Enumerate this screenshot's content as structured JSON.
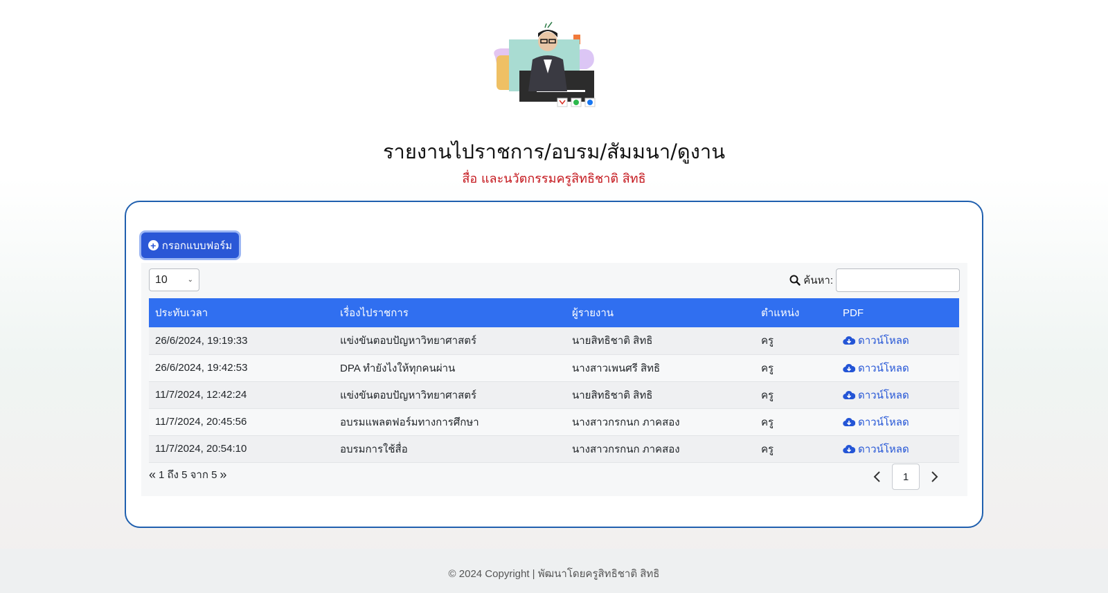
{
  "header": {
    "title": "รายงานไปราชการ/อบรม/สัมมนา/ดูงาน",
    "subtitle": "สื่อ และนวัตกรรมครูสิทธิชาติ สิทธิ"
  },
  "toolbar": {
    "add_form_label": "กรอกแบบฟอร์ม"
  },
  "table_controls": {
    "page_length": "10",
    "search_label": "ค้นหา:",
    "search_value": ""
  },
  "table": {
    "columns": [
      "ประทับเวลา",
      "เรื่องไปราชการ",
      "ผู้รายงาน",
      "ตำแหน่ง",
      "PDF"
    ],
    "rows": [
      {
        "timestamp": "26/6/2024, 19:19:33",
        "subject": "แข่งขันตอบปัญหาวิทยาศาสตร์",
        "reporter": "นายสิทธิชาติ สิทธิ",
        "position": "ครู",
        "pdf": "ดาวน์โหลด"
      },
      {
        "timestamp": "26/6/2024, 19:42:53",
        "subject": "DPA ทำยังไงให้ทุกคนผ่าน",
        "reporter": "นางสาวเพนศรี สิทธิ",
        "position": "ครู",
        "pdf": "ดาวน์โหลด"
      },
      {
        "timestamp": "11/7/2024, 12:42:24",
        "subject": "แข่งขันตอบปัญหาวิทยาศาสตร์",
        "reporter": "นายสิทธิชาติ สิทธิ",
        "position": "ครู",
        "pdf": "ดาวน์โหลด"
      },
      {
        "timestamp": "11/7/2024, 20:45:56",
        "subject": "อบรมแพลตฟอร์มทางการศึกษา",
        "reporter": "นางสาวกรกนก ภาคสอง",
        "position": "ครู",
        "pdf": "ดาวน์โหลด"
      },
      {
        "timestamp": "11/7/2024, 20:54:10",
        "subject": "อบรมการใช้สื่อ",
        "reporter": "นางสาวกรกนก ภาคสอง",
        "position": "ครู",
        "pdf": "ดาวน์โหลด"
      }
    ]
  },
  "pagination": {
    "info": "1 ถึง 5 จาก 5",
    "current_page": "1"
  },
  "footer": {
    "text": "© 2024 Copyright | พัฒนาโดยครูสิทธิชาติ สิทธิ"
  },
  "colors": {
    "accent": "#306ff0",
    "button": "#2a57d6",
    "subtitle": "#c4161c",
    "card_border": "#1f5fae"
  }
}
